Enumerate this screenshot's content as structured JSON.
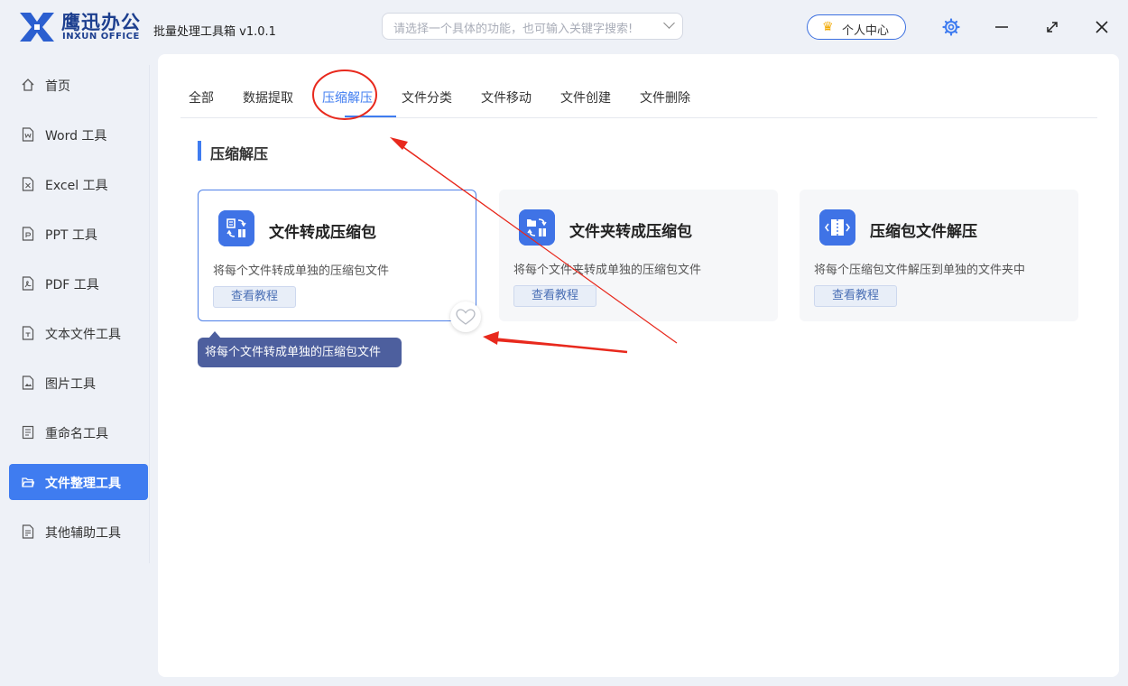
{
  "app": {
    "brand_cn": "鹰迅办公",
    "brand_en": "INXUN OFFICE",
    "title": "批量处理工具箱 v1.0.1"
  },
  "search": {
    "placeholder": "请选择一个具体的功能，也可输入关键字搜索!"
  },
  "user": {
    "label": "个人中心"
  },
  "sidebar": {
    "items": [
      {
        "label": "首页",
        "icon": "home-icon"
      },
      {
        "label": "Word 工具",
        "icon": "word-file-icon"
      },
      {
        "label": "Excel 工具",
        "icon": "excel-file-icon"
      },
      {
        "label": "PPT 工具",
        "icon": "ppt-file-icon"
      },
      {
        "label": "PDF 工具",
        "icon": "pdf-file-icon"
      },
      {
        "label": "文本文件工具",
        "icon": "text-file-icon"
      },
      {
        "label": "图片工具",
        "icon": "image-file-icon"
      },
      {
        "label": "重命名工具",
        "icon": "rename-icon"
      },
      {
        "label": "文件整理工具",
        "icon": "folder-open-icon",
        "active": true
      },
      {
        "label": "其他辅助工具",
        "icon": "misc-tools-icon"
      }
    ]
  },
  "tabs": [
    {
      "label": "全部"
    },
    {
      "label": "数据提取"
    },
    {
      "label": "压缩解压",
      "active": true
    },
    {
      "label": "文件分类"
    },
    {
      "label": "文件移动"
    },
    {
      "label": "文件创建"
    },
    {
      "label": "文件删除"
    }
  ],
  "section": {
    "title": "压缩解压"
  },
  "cards": [
    {
      "title": "文件转成压缩包",
      "desc": "将每个文件转成单独的压缩包文件",
      "button": "查看教程",
      "icon": "file-to-zip-icon",
      "selected": true
    },
    {
      "title": "文件夹转成压缩包",
      "desc": "将每个文件夹转成单独的压缩包文件",
      "button": "查看教程",
      "icon": "folder-to-zip-icon"
    },
    {
      "title": "压缩包文件解压",
      "desc": "将每个压缩包文件解压到单独的文件夹中",
      "button": "查看教程",
      "icon": "unzip-icon"
    }
  ],
  "tooltip": {
    "text": "将每个文件转成单独的压缩包文件"
  },
  "colors": {
    "accent": "#3f7cf0",
    "annotation": "#e8291d",
    "brand": "#1d3f8f"
  }
}
